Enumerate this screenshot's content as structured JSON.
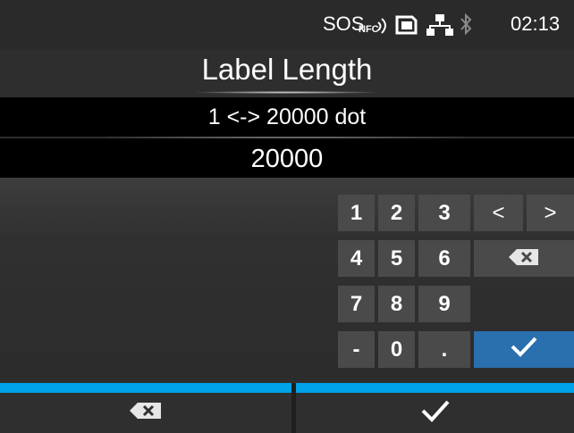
{
  "status_bar": {
    "sos": "SOS",
    "nfc": "NFC",
    "time": "02:13",
    "icons": [
      "nfc-icon",
      "sd-card-icon",
      "network-icon",
      "bluetooth-icon"
    ]
  },
  "header": {
    "title": "Label Length"
  },
  "range": {
    "text": "1 <-> 20000 dot"
  },
  "input": {
    "value": "20000"
  },
  "keypad": {
    "row1": [
      "1",
      "2",
      "3",
      "<",
      ">"
    ],
    "row2": [
      "4",
      "5",
      "6"
    ],
    "row3": [
      "7",
      "8",
      "9"
    ],
    "row4": [
      "-",
      "0",
      "."
    ],
    "backspace_icon": "backspace-icon",
    "confirm_icon": "checkmark-icon"
  },
  "footer": {
    "left_icon": "backspace-icon",
    "right_icon": "checkmark-icon"
  },
  "colors": {
    "accent": "#00a3e8",
    "confirm": "#2a6fae"
  }
}
